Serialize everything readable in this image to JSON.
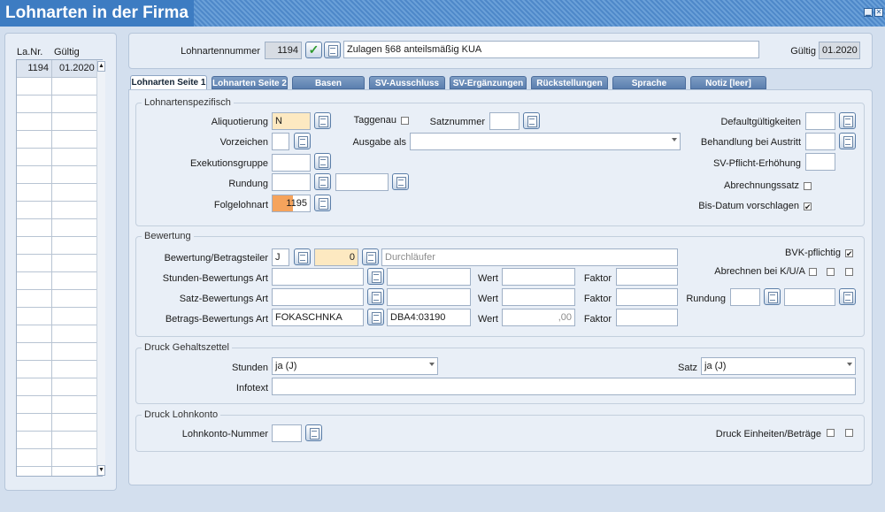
{
  "window": {
    "title": "Lohnarten in der Firma"
  },
  "left_list": {
    "col_nr": "La.Nr.",
    "col_gueltig": "Gültig",
    "rows": [
      {
        "nr": "1194",
        "gueltig": "01.2020"
      }
    ]
  },
  "header": {
    "nr_label": "Lohnartennummer",
    "nr_value": "1194",
    "name_value": "Zulagen §68 anteilsmäßig KUA",
    "gueltig_label": "Gültig",
    "gueltig_value": "01.2020"
  },
  "tabs": [
    "Lohnarten Seite 1",
    "Lohnarten Seite 2",
    "Basen",
    "SV-Ausschluss",
    "SV-Ergänzungen",
    "Rückstellungen",
    "Sprache",
    "Notiz [leer]"
  ],
  "spez": {
    "title": "Lohnartenspezifisch",
    "aliquotierung_label": "Aliquotierung",
    "aliquotierung_value": "N",
    "vorzeichen_label": "Vorzeichen",
    "exekution_label": "Exekutionsgruppe",
    "rundung_label": "Rundung",
    "folge_label": "Folgelohnart",
    "folge_value": "1195",
    "taggenau_label": "Taggenau",
    "satznummer_label": "Satznummer",
    "ausgabe_label": "Ausgabe als",
    "default_label": "Defaultgültigkeiten",
    "austritt_label": "Behandlung bei Austritt",
    "svpflicht_label": "SV-Pflicht-Erhöhung",
    "abrechnungssatz_label": "Abrechnungssatz",
    "bisdatum_label": "Bis-Datum vorschlagen",
    "bisdatum_checked": "✔"
  },
  "bewertung": {
    "title": "Bewertung",
    "bt_label": "Bewertung/Betragsteiler",
    "bt_value": "J",
    "bt_amount": "0",
    "bt_placeholder": "Durchläufer",
    "stunden_label": "Stunden-Bewertungs Art",
    "satz_label": "Satz-Bewertungs Art",
    "betrag_label": "Betrags-Bewertungs Art",
    "betrag_value": "FOKASCHNKA",
    "betrag_value2": "DBA4:03190",
    "wert_label": "Wert",
    "wert3_value": ",00",
    "faktor_label": "Faktor",
    "bvk_label": "BVK-pflichtig",
    "bvk_checked": "✔",
    "kua_label": "Abrechnen bei K/U/A",
    "rundung_label": "Rundung"
  },
  "druck_gehalt": {
    "title": "Druck Gehaltszettel",
    "stunden_label": "Stunden",
    "stunden_value": "ja (J)",
    "satz_label": "Satz",
    "satz_value": "ja (J)",
    "infotext_label": "Infotext"
  },
  "druck_lohnkonto": {
    "title": "Druck Lohnkonto",
    "nummer_label": "Lohnkonto-Nummer",
    "einheiten_label": "Druck Einheiten/Beträge"
  },
  "colors": {
    "accent": "#3d7cc2",
    "title_bg": "#3d7cc2",
    "highlight": "#f5a35c",
    "yellow_field": "#fde9c1"
  }
}
